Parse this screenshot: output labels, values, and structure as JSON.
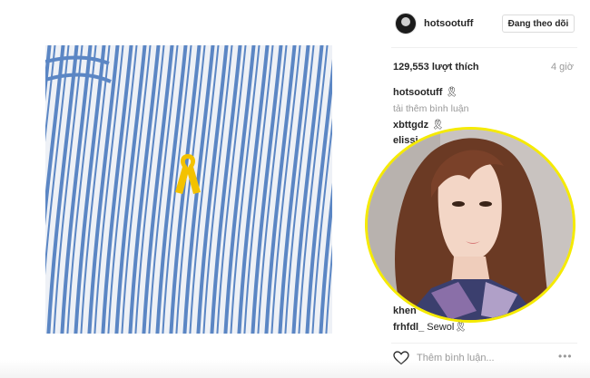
{
  "post": {
    "username": "hotsootuff",
    "follow_label": "Đang theo dõi",
    "likes": "129,553 lượt thích",
    "time": "4 giờ",
    "caption_emoji": "🎗",
    "load_more": "tải thêm bình luận",
    "comments": [
      {
        "user": "xbttgdz",
        "text": "🎗"
      },
      {
        "user": "elissi",
        "text": ""
      },
      {
        "user": "khen",
        "text": ""
      },
      {
        "user": "frhfdl_",
        "text": "Sewol🎗"
      }
    ],
    "add_comment_placeholder": "Thêm bình luận...",
    "more_icon": "•••"
  },
  "colors": {
    "accent_yellow": "#f5ea00",
    "ribbon": "#f3c200",
    "stripe_blue": "#5b86c4"
  }
}
